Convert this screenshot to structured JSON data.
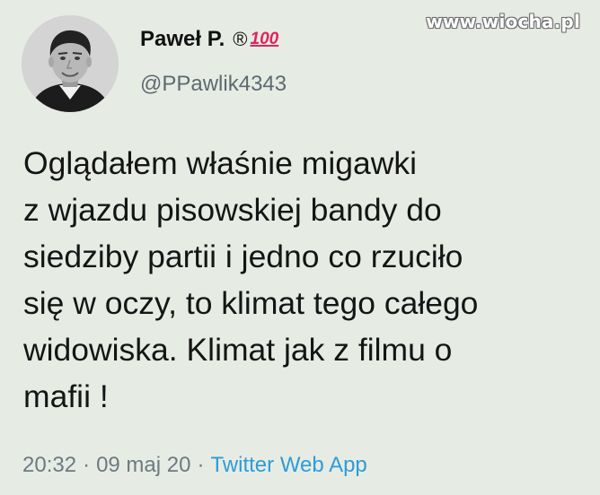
{
  "watermark": "www.wiocha.pl",
  "author": {
    "display_name": "Paweł P.",
    "badge_registered": "®",
    "badge_hundred": "100",
    "handle": "@PPawlik4343"
  },
  "tweet": {
    "lines": [
      "Oglądałem właśnie migawki",
      "z wjazdu pisowskiej bandy do",
      "siedziby partii i jedno co rzuciło",
      "się w oczy, to klimat tego całego",
      "widowiska. Klimat jak z filmu o",
      "mafii !"
    ]
  },
  "meta": {
    "time": "20:32",
    "separator": "·",
    "date": "09 maj 20",
    "source": "Twitter Web App"
  },
  "colors": {
    "background": "#e6ece4",
    "source_link": "#2f9bd8",
    "hundred_emoji": "#e0245e"
  },
  "icons": {
    "avatar": "profile-photo",
    "hundred": "hundred-points-emoji"
  }
}
